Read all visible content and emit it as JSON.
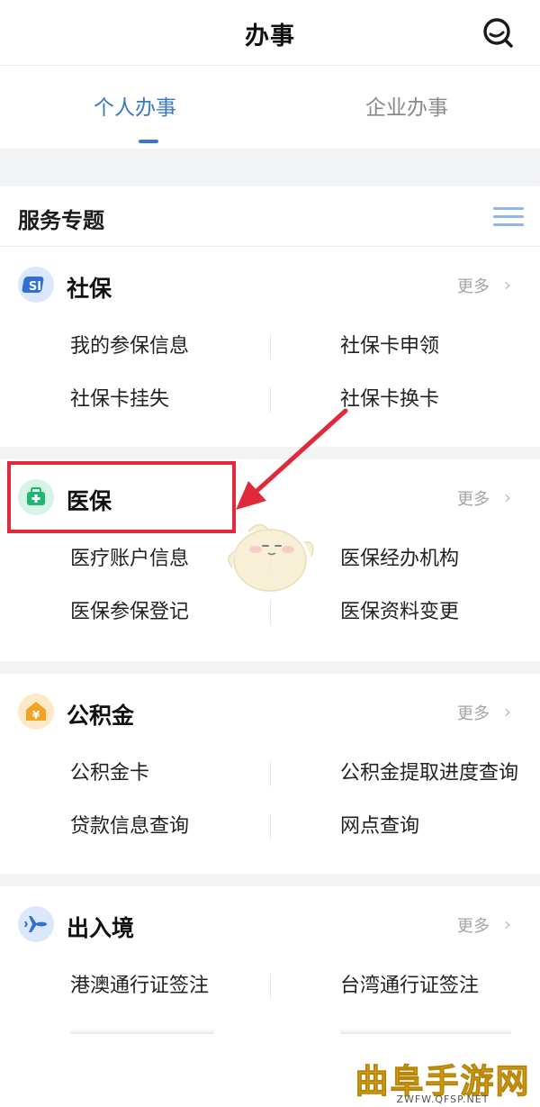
{
  "header": {
    "title": "办事"
  },
  "tabs": [
    {
      "label": "个人办事",
      "active": true
    },
    {
      "label": "企业办事",
      "active": false
    }
  ],
  "services_section": {
    "title": "服务专题"
  },
  "colors": {
    "accent": "#3a78c8",
    "highlight": "#e02a3b",
    "social_icon": "#2f6fd6",
    "medical_icon": "#22b573",
    "fund_icon": "#f2a324",
    "travel_icon": "#2f6fd6"
  },
  "categories": [
    {
      "title": "社保",
      "icon": "social-security-icon",
      "more": "更多",
      "items": [
        "我的参保信息",
        "社保卡申领",
        "社保卡挂失",
        "社保卡换卡"
      ]
    },
    {
      "title": "医保",
      "icon": "medical-kit-icon",
      "more": "更多",
      "items": [
        "医疗账户信息",
        "医保经办机构",
        "医保参保登记",
        "医保资料变更"
      ]
    },
    {
      "title": "公积金",
      "icon": "housing-fund-icon",
      "more": "更多",
      "items": [
        "公积金卡",
        "公积金提取进度查询",
        "贷款信息查询",
        "网点查询"
      ]
    },
    {
      "title": "出入境",
      "icon": "airplane-icon",
      "more": "更多",
      "items": [
        "港澳通行证签注",
        "台湾通行证签注"
      ]
    }
  ],
  "watermark": {
    "text": "曲阜手游网",
    "url": "ZWFW.QFSP.NET"
  }
}
